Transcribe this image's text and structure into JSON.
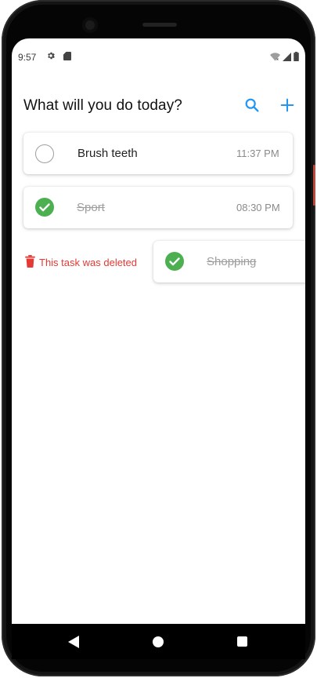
{
  "status": {
    "time": "9:57",
    "icons": [
      "gear-icon",
      "sd-card-icon",
      "wifi-icon",
      "signal-icon",
      "battery-icon"
    ]
  },
  "header": {
    "title": "What will you do today?",
    "search_icon": "search-icon",
    "add_icon": "plus-icon"
  },
  "tasks": [
    {
      "label": "Brush teeth",
      "time": "11:37 PM",
      "done": false
    },
    {
      "label": "Sport",
      "time": "08:30 PM",
      "done": true
    },
    {
      "label": "Shopping",
      "time": "",
      "done": true
    }
  ],
  "deleted_notice": {
    "text": "This task was deleted",
    "icon": "trash-icon"
  },
  "colors": {
    "accent": "#2196f3",
    "done_green": "#4caf50",
    "delete_red": "#e53935"
  },
  "navbar": {
    "icons": [
      "back-icon",
      "home-icon",
      "recents-icon"
    ]
  }
}
